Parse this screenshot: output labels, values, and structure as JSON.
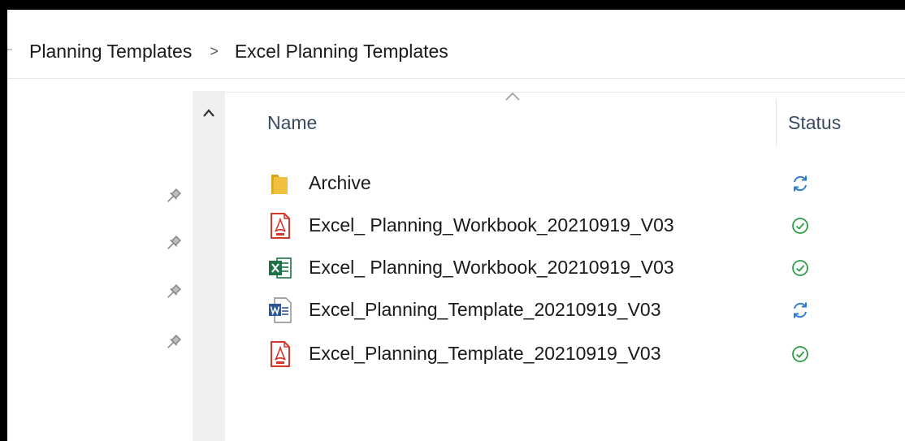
{
  "breadcrumb": {
    "items": [
      "Planning Templates",
      "Excel Planning Templates"
    ],
    "separator": ">"
  },
  "columns": {
    "name": "Name",
    "status": "Status"
  },
  "files": [
    {
      "name": "Archive",
      "type": "folder-icon",
      "status": "sync-pending-icon"
    },
    {
      "name": "Excel_ Planning_Workbook_20210919_V03",
      "type": "pdf-file-icon",
      "status": "available-icon"
    },
    {
      "name": "Excel_ Planning_Workbook_20210919_V03",
      "type": "excel-file-icon",
      "status": "available-icon"
    },
    {
      "name": "Excel_Planning_Template_20210919_V03",
      "type": "word-file-icon",
      "status": "sync-pending-icon"
    },
    {
      "name": "Excel_Planning_Template_20210919_V03",
      "type": "pdf-file-icon",
      "status": "available-icon"
    }
  ],
  "colors": {
    "sync_blue": "#2a7ad2",
    "available_green": "#2e9e46",
    "folder_yellow": "#f2c040",
    "pdf_red": "#d6372b",
    "excel_green": "#1e7145",
    "word_blue": "#2b5797",
    "header_text": "#3a4a63"
  }
}
